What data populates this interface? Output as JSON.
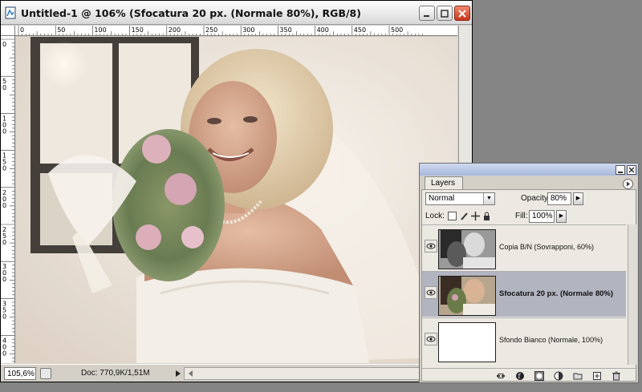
{
  "document": {
    "title": "Untitled-1 @ 106% (Sfocatura 20 px. (Normale 80%), RGB/8)",
    "zoom": "105,6%",
    "doc_info": "Doc: 770,9K/1,51M",
    "ruler_h": [
      "0",
      "50",
      "100",
      "150",
      "200",
      "250",
      "300",
      "350",
      "400",
      "450",
      "500"
    ],
    "ruler_v": [
      "0",
      "50",
      "100",
      "150",
      "200",
      "250",
      "300",
      "350",
      "400"
    ]
  },
  "layers_panel": {
    "tab_label": "Layers",
    "blend_mode": "Normal",
    "opacity_label": "Opacity:",
    "opacity_value": "80%",
    "lock_label": "Lock:",
    "fill_label": "Fill:",
    "fill_value": "100%",
    "layers": [
      {
        "name": "Copia B/N (Sovrapponi, 60%)",
        "selected": false,
        "visible": true
      },
      {
        "name": "Sfocatura 20 px. (Normale 80%)",
        "selected": true,
        "visible": true
      },
      {
        "name": "Sfondo Bianco (Normale, 100%)",
        "selected": false,
        "visible": true
      }
    ]
  },
  "colors": {
    "workspace": "#848484",
    "selected_layer": "#b2b4c0",
    "close_button": "#c8361a"
  }
}
